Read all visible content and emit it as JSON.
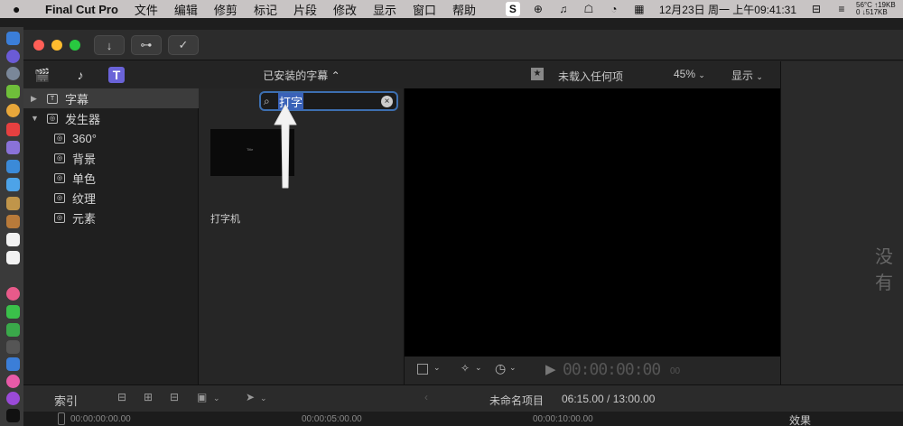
{
  "menubar": {
    "app_name": "Final Cut Pro",
    "items": [
      "文件",
      "编辑",
      "修剪",
      "标记",
      "片段",
      "修改",
      "显示",
      "窗口",
      "帮助"
    ],
    "clock": "12月23日 周一 上午09:41:31",
    "stats_temp": "56°C",
    "stats_up": "↑19KB",
    "stats_down": "0 ↓517KB"
  },
  "library": {
    "browser_title": "已安装的字幕 ⌃",
    "sidebar": [
      {
        "label": "字幕",
        "selected": true,
        "disclosure": "▶",
        "icon": "T"
      },
      {
        "label": "发生器",
        "selected": false,
        "disclosure": "▼",
        "icon": "◎"
      },
      {
        "label": "360°",
        "selected": false,
        "disclosure": "",
        "icon": "◎"
      },
      {
        "label": "背景",
        "selected": false,
        "disclosure": "",
        "icon": "◎"
      },
      {
        "label": "单色",
        "selected": false,
        "disclosure": "",
        "icon": "◎"
      },
      {
        "label": "纹理",
        "selected": false,
        "disclosure": "",
        "icon": "◎"
      },
      {
        "label": "元素",
        "selected": false,
        "disclosure": "",
        "icon": "◎"
      }
    ]
  },
  "search": {
    "query": "打字"
  },
  "clip": {
    "label": "打字机",
    "thumb_text": "Title"
  },
  "viewer": {
    "title": "未载入任何项",
    "zoom": "45%",
    "display_menu": "显示",
    "timecode": "00:00:00:00",
    "timecode_frames": "00"
  },
  "inspector": {
    "partial_text": "没有"
  },
  "timeline": {
    "index_label": "索引",
    "project_name": "未命名项目",
    "duration": "06:15.00 / 13:00.00",
    "ruler_marks": [
      "00:00:00:00.00",
      "00:00:05:00.00",
      "00:00:10:00.00"
    ],
    "effects_label": "效果"
  }
}
